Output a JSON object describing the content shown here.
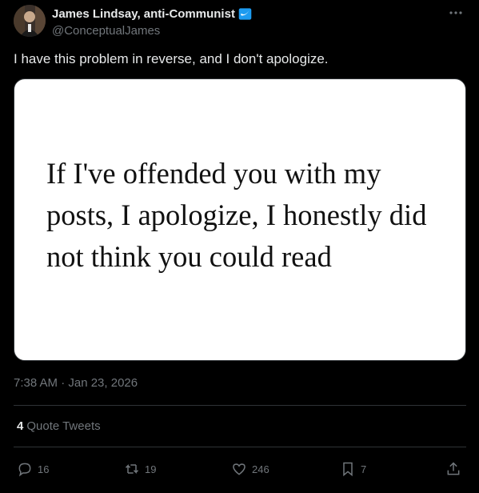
{
  "author": {
    "display_name": "James Lindsay, anti-Communist",
    "handle": "@ConceptualJames",
    "verified_color": "#1d9bf0"
  },
  "more_icon": "more-horizontal-icon",
  "tweet_text": "I have this problem in reverse, and I don't apologize.",
  "media": {
    "lines": [
      "If I've offended you with my",
      "posts, I apologize, I honestly did",
      "not think you could read"
    ]
  },
  "timestamp": "7:38 AM · Jan 23, 2026",
  "quote_tweets": {
    "count": "4",
    "label": "Quote Tweets"
  },
  "actions": {
    "reply": {
      "icon": "reply-icon",
      "count": "16"
    },
    "retweet": {
      "icon": "retweet-icon",
      "count": "19"
    },
    "like": {
      "icon": "heart-icon",
      "count": "246"
    },
    "bookmark": {
      "icon": "bookmark-icon",
      "count": "7"
    },
    "share": {
      "icon": "share-icon"
    }
  },
  "colors": {
    "background": "#000000",
    "primary_text": "#e7e9ea",
    "secondary_text": "#71767b",
    "divider": "#2f3336",
    "accent": "#1d9bf0"
  }
}
